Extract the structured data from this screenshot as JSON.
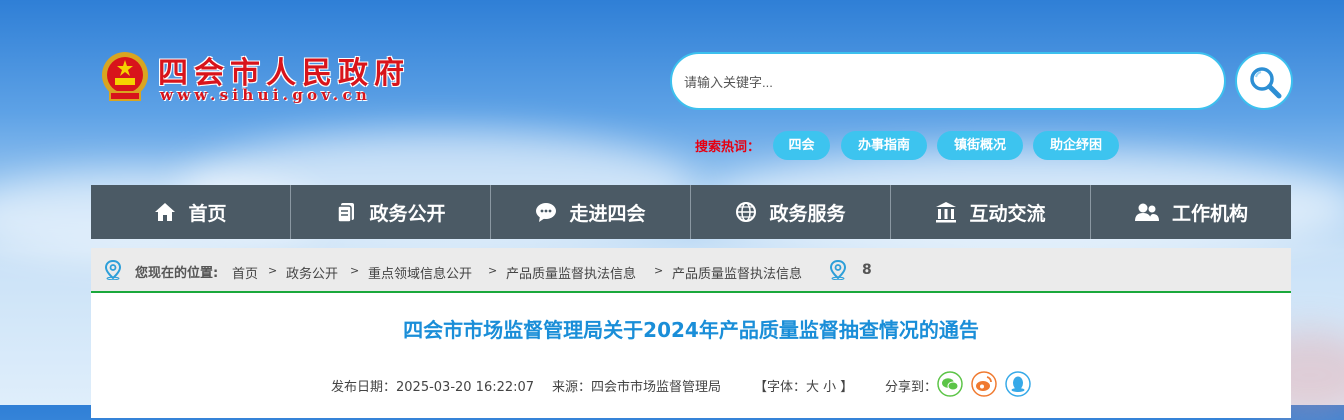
{
  "header": {
    "site_name": "四会市人民政府",
    "site_url": "www.sihui.gov.cn"
  },
  "search": {
    "placeholder": "请输入关键字...",
    "hot_label": "搜索热词：",
    "hot_tags": [
      "四会",
      "办事指南",
      "镇街概况",
      "助企纾困"
    ]
  },
  "nav": {
    "items": [
      {
        "label": "首页",
        "icon": "home-icon"
      },
      {
        "label": "政务公开",
        "icon": "document-icon"
      },
      {
        "label": "走进四会",
        "icon": "chat-icon"
      },
      {
        "label": "政务服务",
        "icon": "globe-icon"
      },
      {
        "label": "互动交流",
        "icon": "building-icon"
      },
      {
        "label": "工作机构",
        "icon": "users-icon"
      }
    ]
  },
  "breadcrumb": {
    "prefix": "您现在的位置:",
    "items": [
      "首页",
      "政务公开",
      "重点领域信息公开",
      "产品质量监督执法信息",
      "产品质量监督执法信息"
    ],
    "separator": ">",
    "count": "8"
  },
  "article": {
    "title": "四会市市场监督管理局关于2024年产品质量监督抽查情况的通告",
    "date": "发布日期：2025-03-20 16:22:07",
    "source": "来源：四会市市场监督管理局",
    "font_size": "【字体：大 小 】",
    "share_label": "分享到：",
    "share_icons": [
      "wechat-icon",
      "weibo-icon",
      "qq-icon"
    ]
  },
  "colors": {
    "accent": "#3dc4ef",
    "brand_red": "#d8141b",
    "nav_bg": "#4b5a65",
    "title_blue": "#1a8ed8",
    "crumb_border": "#1aa83b"
  }
}
